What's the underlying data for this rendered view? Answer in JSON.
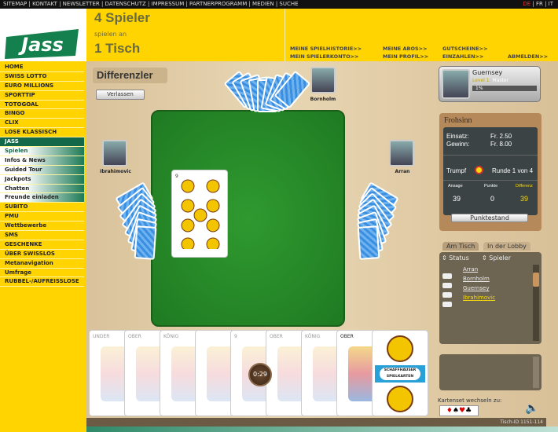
{
  "topbar": {
    "links": "SITEMAP | KONTAKT | NEWSLETTER | DATENSCHUTZ | IMPRESSUM | PARTNERPROGRAMM | MEDIEN | SUCHE",
    "lang_active": "DE",
    "lang_rest": " | FR | IT"
  },
  "logo": {
    "text": "Jass"
  },
  "header": {
    "players": "4 Spieler",
    "spielen_an": "spielen an",
    "tables": "1 Tisch",
    "links": [
      "MEINE SPIELHISTORIE>>",
      "MEIN SPIELERKONTO>>",
      "MEINE ABOS>>",
      "MEIN PROFIL>>",
      "GUTSCHEINE>>",
      "EINZAHLEN>>",
      "ABMELDEN>>"
    ]
  },
  "nav": [
    "HOME",
    "SWISS LOTTO",
    "EURO MILLIONS",
    "SPORTTIP",
    "TOTOGOAL",
    "BINGO",
    "CLIX",
    "LOSE KLASSISCH",
    "JASS",
    "Spielen",
    "Infos & News",
    "Guided Tour",
    "Jackpots",
    "Chatten",
    "Freunde einladen",
    "SUBITO",
    "PMU",
    "Wettbewerbe",
    "SMS",
    "GESCHENKE",
    "ÜBER SWISSLOS",
    "Metanavigation",
    "Umfrage",
    "RUBBEL-/AUFREISSLOSE"
  ],
  "game": {
    "title": "Differenzler",
    "leave": "Verlassen",
    "timer": "0:29",
    "players": {
      "top": "Bornholm",
      "left": "Ibrahimovic",
      "right": "Arran"
    },
    "hand": [
      "UNDER",
      "OBER",
      "KÖNIG",
      "",
      "9",
      "OBER",
      "KÖNIG",
      "OBER",
      ""
    ],
    "trick_card": "9",
    "card_brand": "SCHAFFHAUSER SPIELKARTEN",
    "card_brand_sub": "Müller Original"
  },
  "profile": {
    "name": "Guernsey",
    "level": "Level 1:",
    "rank": "Master",
    "progress": "1%"
  },
  "info": {
    "title": "Frohsinn",
    "einsatz_label": "Einsatz:",
    "einsatz": "Fr. 2.50",
    "gewinn_label": "Gewinn:",
    "gewinn": "Fr. 8.00",
    "trumpf": "Trumpf",
    "round": "Runde 1 von 4",
    "cols": [
      "Ansage",
      "Punkte",
      "Differenz"
    ],
    "vals": [
      "39",
      "0",
      "39"
    ],
    "button": "Punktestand",
    "accent": "#f5d90a"
  },
  "players_panel": {
    "tabs": [
      "Am Tisch",
      "In der Lobby"
    ],
    "cols": [
      "Status",
      "Spieler"
    ],
    "list": [
      "Arran",
      "Bornholm",
      "Guernsey",
      "Ibrahimovic"
    ]
  },
  "footer": {
    "cardset_label": "Kartenset wechseln zu:",
    "table_id": "Tisch-ID 1151-114"
  }
}
